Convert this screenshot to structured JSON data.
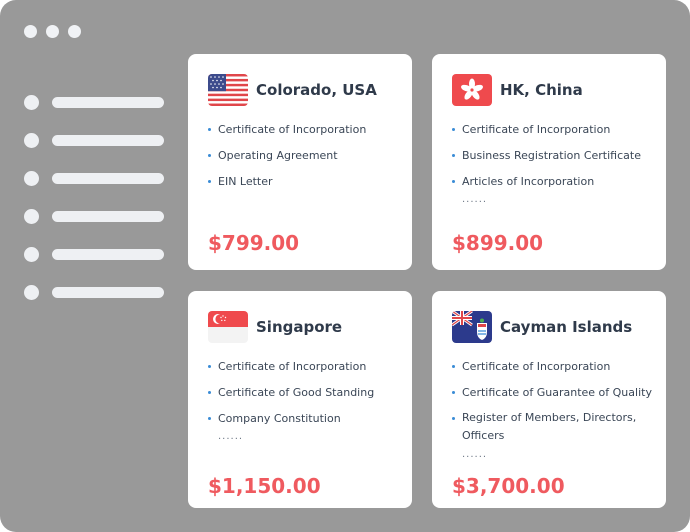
{
  "colors": {
    "window_bg": "#999999",
    "card_bg": "#ffffff",
    "price": "#ef5a5f",
    "bullet": "#3a8cd6",
    "title": "#2f3a4a"
  },
  "cards": [
    {
      "title": "Colorado, USA",
      "flag_icon": "us-flag-icon",
      "items": [
        "Certificate of Incorporation",
        "Operating Agreement",
        "EIN Letter"
      ],
      "more": "",
      "price": "$799.00"
    },
    {
      "title": "HK, China",
      "flag_icon": "hong-kong-flag-icon",
      "items": [
        "Certificate of Incorporation",
        "Business Registration Certificate",
        "Articles of Incorporation"
      ],
      "more": "......",
      "price": "$899.00"
    },
    {
      "title": "Singapore",
      "flag_icon": "singapore-flag-icon",
      "items": [
        "Certificate of Incorporation",
        "Certificate of Good Standing",
        "Company Constitution"
      ],
      "more": "......",
      "price": "$1,150.00"
    },
    {
      "title": "Cayman Islands",
      "flag_icon": "cayman-islands-flag-icon",
      "items": [
        "Certificate of Incorporation",
        "Certificate of Guarantee of Quality",
        "Register of Members, Directors, Officers"
      ],
      "more": "......",
      "price": "$3,700.00"
    }
  ]
}
